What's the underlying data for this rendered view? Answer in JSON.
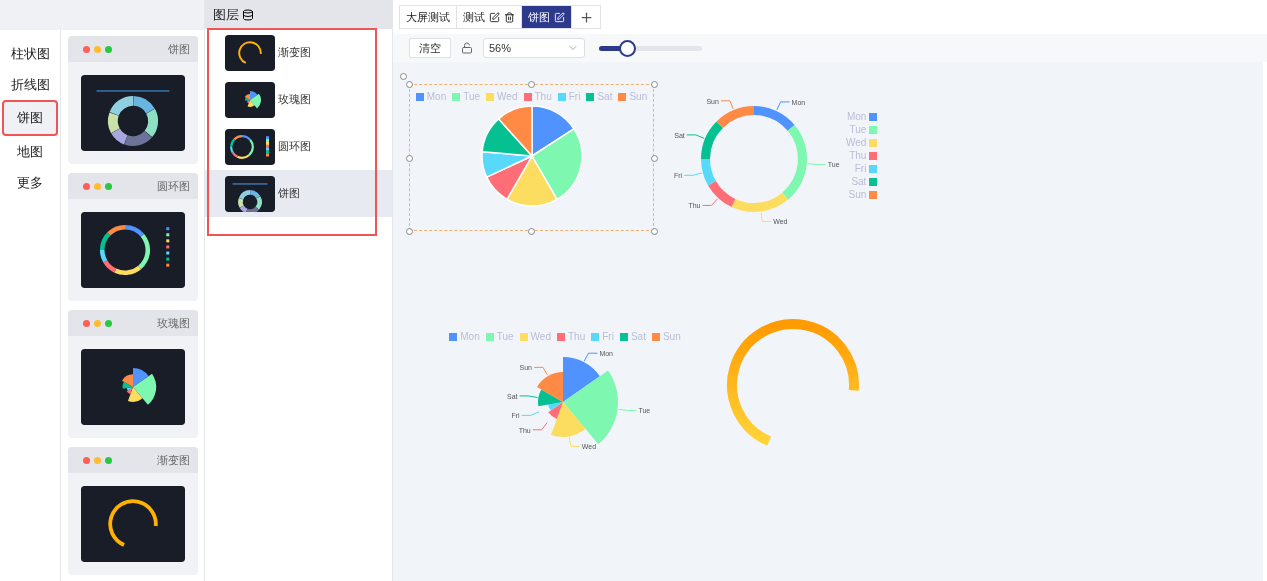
{
  "categories": [
    {
      "label": "柱状图",
      "selected": false,
      "highlighted": false
    },
    {
      "label": "折线图",
      "selected": false,
      "highlighted": false
    },
    {
      "label": "饼图",
      "selected": true,
      "highlighted": true
    },
    {
      "label": "地图",
      "selected": false,
      "highlighted": false
    },
    {
      "label": "更多",
      "selected": false,
      "highlighted": false
    }
  ],
  "templates": [
    {
      "title": "饼图",
      "kind": "donut"
    },
    {
      "title": "圆环图",
      "kind": "ring"
    },
    {
      "title": "玫瑰图",
      "kind": "rose"
    },
    {
      "title": "渐变图",
      "kind": "gradient"
    }
  ],
  "layers": {
    "title": "图层",
    "highlighted": true,
    "items": [
      {
        "label": "渐变图",
        "kind": "gradient",
        "selected": false
      },
      {
        "label": "玫瑰图",
        "kind": "rose",
        "selected": false
      },
      {
        "label": "圆环图",
        "kind": "ring",
        "selected": false
      },
      {
        "label": "饼图",
        "kind": "donut",
        "selected": true
      }
    ]
  },
  "tabs": [
    {
      "label": "大屏测试",
      "selected": false,
      "editable": false,
      "deletable": false
    },
    {
      "label": "测试",
      "selected": false,
      "editable": true,
      "deletable": true
    },
    {
      "label": "饼图",
      "selected": true,
      "editable": true,
      "deletable": false
    }
  ],
  "toolbar": {
    "clear_button": "清空",
    "locked": false,
    "zoom": "56%",
    "zoom_slider": {
      "level": 0.27
    }
  },
  "canvas": {
    "charts": [
      {
        "kind": "pie",
        "selected": true,
        "legend": [
          {
            "label": "Mon",
            "color": "#5093ff"
          },
          {
            "label": "Tue",
            "color": "#7ef7b0"
          },
          {
            "label": "Wed",
            "color": "#fddd60"
          },
          {
            "label": "Thu",
            "color": "#ff6e76"
          },
          {
            "label": "Fri",
            "color": "#58d9f9"
          },
          {
            "label": "Sat",
            "color": "#05c091"
          },
          {
            "label": "Sun",
            "color": "#ff8a45"
          }
        ]
      },
      {
        "kind": "ring",
        "selected": false,
        "slice_labels": [
          "Mon",
          "Tue",
          "Wed",
          "Thu",
          "Fri",
          "Sat",
          "Sun"
        ],
        "legend": [
          {
            "label": "Mon",
            "color": "#5093ff"
          },
          {
            "label": "Tue",
            "color": "#7ef7b0"
          },
          {
            "label": "Wed",
            "color": "#fddd60"
          },
          {
            "label": "Thu",
            "color": "#ff6e76"
          },
          {
            "label": "Fri",
            "color": "#58d9f9"
          },
          {
            "label": "Sat",
            "color": "#05c091"
          },
          {
            "label": "Sun",
            "color": "#ff8a45"
          }
        ]
      },
      {
        "kind": "rose",
        "selected": false,
        "slice_labels": [
          "Mon",
          "Tue",
          "Wed",
          "Thu",
          "Fri",
          "Sat",
          "Sun"
        ],
        "legend": [
          {
            "label": "Mon",
            "color": "#5093ff"
          },
          {
            "label": "Tue",
            "color": "#7ef7b0"
          },
          {
            "label": "Wed",
            "color": "#fddd60"
          },
          {
            "label": "Thu",
            "color": "#ff6e76"
          },
          {
            "label": "Fri",
            "color": "#58d9f9"
          },
          {
            "label": "Sat",
            "color": "#05c091"
          },
          {
            "label": "Sun",
            "color": "#ff8a45"
          }
        ]
      },
      {
        "kind": "gradient",
        "selected": false
      }
    ]
  }
}
